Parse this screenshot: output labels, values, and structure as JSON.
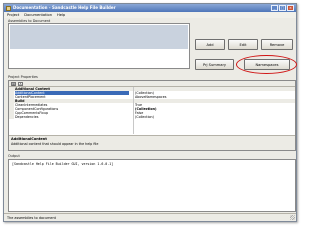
{
  "window": {
    "title": "Documentation - Sandcastle Help File Builder",
    "controls": {
      "minimize": "_",
      "maximize": "□",
      "close": "×"
    }
  },
  "menu": [
    "Project",
    "Documentation",
    "Help"
  ],
  "assemblies": {
    "label": "Assemblies to Document",
    "rows": 6
  },
  "buttons": {
    "add": "Add",
    "edit": "Edit",
    "remove": "Remove",
    "nsummary": "Prj Summary",
    "namespaces": "Namespaces"
  },
  "properties": {
    "label": "Project Properties",
    "toolbar_icons": [
      "categorized-icon",
      "alphabetical-icon"
    ],
    "rows": [
      {
        "type": "section",
        "name": "Additional Content",
        "value": ""
      },
      {
        "type": "item",
        "name": "AdditionalContent",
        "value": "(Collection)",
        "selected": true
      },
      {
        "type": "item",
        "name": "ContentPlacement",
        "value": "AboveNamespaces"
      },
      {
        "type": "section",
        "name": "Build",
        "value": ""
      },
      {
        "type": "item",
        "name": "CleanIntermediates",
        "value": "True"
      },
      {
        "type": "item",
        "name": "ComponentConfigurations",
        "value": "(Collection)"
      },
      {
        "type": "item",
        "name": "CppCommentsFixup",
        "value": "False"
      },
      {
        "type": "item",
        "name": "Dependencies",
        "value": "(Collection)"
      }
    ],
    "description_title": "AdditionalContent",
    "description_text": "Additional content that should appear in the help file"
  },
  "output": {
    "label": "Output",
    "text": "[Sandcastle Help File Builder GUI, version 1.6.0.1]"
  },
  "status": {
    "text": "The assemblies to document"
  },
  "colors": {
    "titlebar": "#4e76b9",
    "highlight": "#d01616",
    "selection": "#3a6ab7"
  }
}
